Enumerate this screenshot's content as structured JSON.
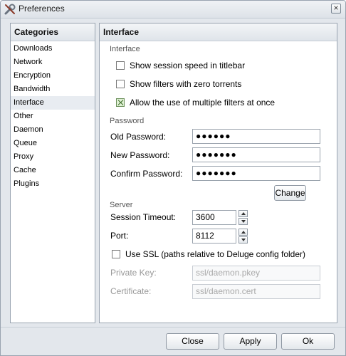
{
  "window": {
    "title": "Preferences",
    "close_glyph": "×",
    "icon": "wrench-icon"
  },
  "categories": {
    "header": "Categories",
    "items": [
      "Downloads",
      "Network",
      "Encryption",
      "Bandwidth",
      "Interface",
      "Other",
      "Daemon",
      "Queue",
      "Proxy",
      "Cache",
      "Plugins"
    ],
    "selected": "Interface"
  },
  "main": {
    "header": "Interface",
    "interface": {
      "label": "Interface",
      "session_speed": {
        "label": "Show session speed in titlebar",
        "checked": false
      },
      "zero_torrents": {
        "label": "Show filters with zero torrents",
        "checked": false
      },
      "multiple_filters": {
        "label": "Allow the use of multiple filters at once",
        "checked": true
      }
    },
    "password": {
      "label": "Password",
      "old_label": "Old Password:",
      "old_value": "●●●●●●",
      "new_label": "New Password:",
      "new_value": "●●●●●●●",
      "confirm_label": "Confirm Password:",
      "confirm_value": "●●●●●●●",
      "change_button": "Change"
    },
    "server": {
      "label": "Server",
      "timeout_label": "Session Timeout:",
      "timeout_value": "3600",
      "port_label": "Port:",
      "port_value": "8112",
      "ssl_label": "Use SSL (paths relative to Deluge config folder)",
      "ssl_checked": false,
      "key_label": "Private Key:",
      "key_value": "ssl/daemon.pkey",
      "cert_label": "Certificate:",
      "cert_value": "ssl/daemon.cert"
    }
  },
  "footer": {
    "close": "Close",
    "apply": "Apply",
    "ok": "Ok"
  }
}
